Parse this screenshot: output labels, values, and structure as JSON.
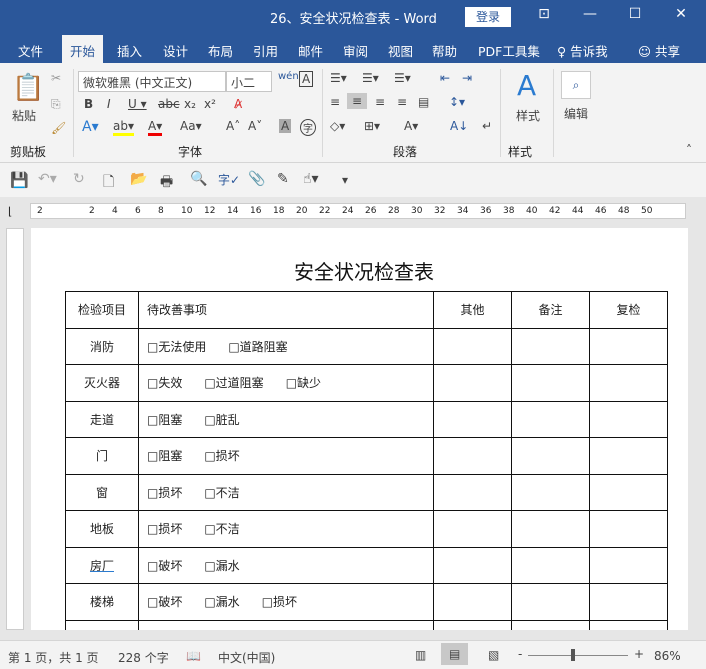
{
  "window": {
    "title": "26、安全状况检查表  -  Word",
    "login": "登录"
  },
  "tabs": [
    "文件",
    "开始",
    "插入",
    "设计",
    "布局",
    "引用",
    "邮件",
    "审阅",
    "视图",
    "帮助",
    "PDF工具集",
    "告诉我",
    "共享"
  ],
  "ribbon": {
    "paste": "粘贴",
    "font_name": "微软雅黑 (中文正文)",
    "font_size": "小二",
    "styles": "样式",
    "edit": "编辑",
    "groups": [
      "剪贴板",
      "字体",
      "段落",
      "样式"
    ]
  },
  "ruler": [
    "2",
    "2",
    "4",
    "6",
    "8",
    "10",
    "12",
    "14",
    "16",
    "18",
    "20",
    "22",
    "24",
    "26",
    "28",
    "30",
    "32",
    "34",
    "36",
    "38",
    "40",
    "42",
    "44",
    "46",
    "48",
    "50"
  ],
  "document": {
    "title": "安全状况检查表",
    "headers": [
      "检验项目",
      "待改善事项",
      "其他",
      "备注",
      "复检"
    ],
    "rows": [
      {
        "item": "消防",
        "options": [
          "□无法使用",
          "□道路阻塞"
        ]
      },
      {
        "item": "灭火器",
        "options": [
          "□失效",
          "□过道阻塞",
          "□缺少"
        ]
      },
      {
        "item": "走道",
        "options": [
          "□阻塞",
          "□脏乱"
        ]
      },
      {
        "item": "门",
        "options": [
          "□阻塞",
          "□损坏"
        ]
      },
      {
        "item": "窗",
        "options": [
          "□损坏",
          "□不洁"
        ]
      },
      {
        "item": "地板",
        "options": [
          "□损坏",
          "□不洁"
        ]
      },
      {
        "item": "房厂",
        "options": [
          "□破坏",
          "□漏水"
        ]
      },
      {
        "item": "楼梯",
        "options": [
          "□破坏",
          "□漏水",
          "□损坏"
        ]
      }
    ]
  },
  "status": {
    "page": "第 1 页，共 1 页",
    "words": "228 个字",
    "lang": "中文(中国)",
    "zoom": "86%"
  }
}
